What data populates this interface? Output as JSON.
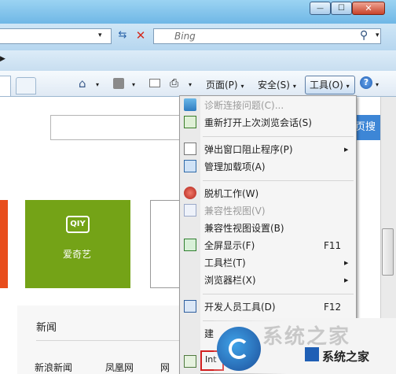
{
  "window": {
    "min_glyph": "—",
    "max_glyph": "☐",
    "close_glyph": "✕"
  },
  "address_bar": {
    "refresh_glyph": "⇆",
    "stop_glyph": "✕",
    "dropdown_glyph": "▾"
  },
  "search": {
    "placeholder": "Bing",
    "icon_glyph": "⚲"
  },
  "command_bar": {
    "page_label": "页面(P)",
    "safety_label": "安全(S)",
    "tools_label": "工具(O)",
    "dropdown_glyph": "▾",
    "help_glyph": "?",
    "home_glyph": "⌂",
    "print_glyph": "⎙"
  },
  "page": {
    "search_button": "页搜",
    "tile_iqiyi_logo": "QIY",
    "tile_iqiyi_label": "爱奇艺",
    "news_title": "新闻",
    "news_links": [
      "新浪新闻",
      "凤凰网",
      "网"
    ]
  },
  "tools_menu": {
    "items": [
      {
        "label": "诊断连接问题(C)...",
        "enabled": false,
        "shortcut": ""
      },
      {
        "label": "重新打开上次浏览会话(S)",
        "enabled": true,
        "shortcut": ""
      },
      {
        "label": "弹出窗口阻止程序(P)",
        "enabled": true,
        "shortcut": ""
      },
      {
        "label": "管理加载项(A)",
        "enabled": true,
        "shortcut": ""
      },
      {
        "label": "脱机工作(W)",
        "enabled": true,
        "shortcut": ""
      },
      {
        "label": "兼容性视图(V)",
        "enabled": false,
        "shortcut": ""
      },
      {
        "label": "兼容性视图设置(B)",
        "enabled": true,
        "shortcut": ""
      },
      {
        "label": "全屏显示(F)",
        "enabled": true,
        "shortcut": "F11"
      },
      {
        "label": "工具栏(T)",
        "enabled": true,
        "shortcut": ""
      },
      {
        "label": "浏览器栏(X)",
        "enabled": true,
        "shortcut": ""
      },
      {
        "label": "开发人员工具(D)",
        "enabled": true,
        "shortcut": "F12"
      },
      {
        "label": "建",
        "enabled": true,
        "shortcut": ""
      },
      {
        "label": "Int",
        "enabled": true,
        "shortcut": ""
      }
    ],
    "submenu_glyph": "▶"
  },
  "watermark": {
    "text": "系统之家",
    "faded_text": "系统之家"
  },
  "colors": {
    "accent_blue": "#3d86d6",
    "iqiyi_green": "#74a317",
    "orange_tile": "#e84d1c",
    "highlight_red": "#d22020"
  }
}
